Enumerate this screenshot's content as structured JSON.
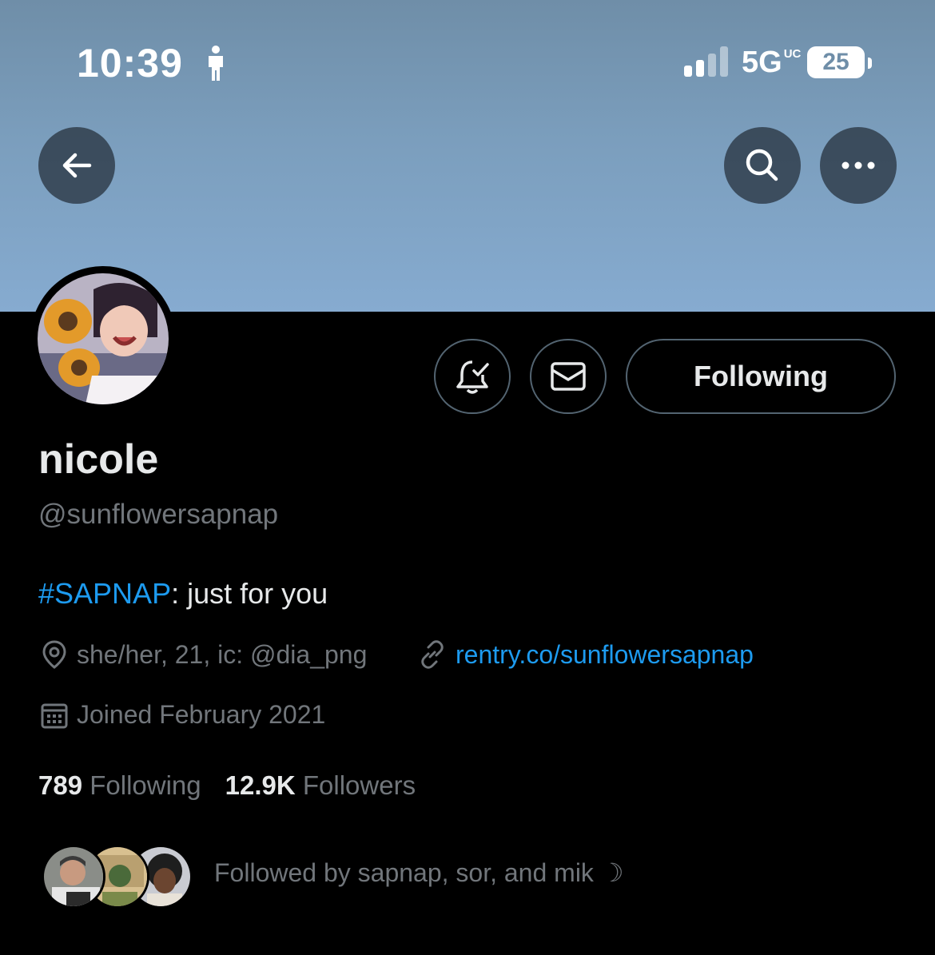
{
  "status_bar": {
    "time": "10:39",
    "network": "5G",
    "network_suffix": "UC",
    "battery": "25"
  },
  "header": {
    "back_icon": "arrow-left-icon",
    "search_icon": "search-icon",
    "more_icon": "more-horizontal-icon"
  },
  "profile": {
    "display_name": "nicole",
    "handle": "@sunflowersapnap",
    "bio_hashtag": "#SAPNAP",
    "bio_text": ": just for you",
    "location": "she/her, 21, ic: @dia_png",
    "website": "rentry.co/sunflowersapnap",
    "joined": "Joined February 2021",
    "following_count": "789",
    "following_label": "Following",
    "followers_count": "12.9K",
    "followers_label": "Followers",
    "followed_by": "Followed by sapnap, sor, and mik ☽"
  },
  "actions": {
    "notify_icon": "bell-check-icon",
    "message_icon": "envelope-icon",
    "following_button": "Following"
  },
  "colors": {
    "accent": "#1d9bf0",
    "secondary_text": "#71767b",
    "background": "#000000"
  }
}
